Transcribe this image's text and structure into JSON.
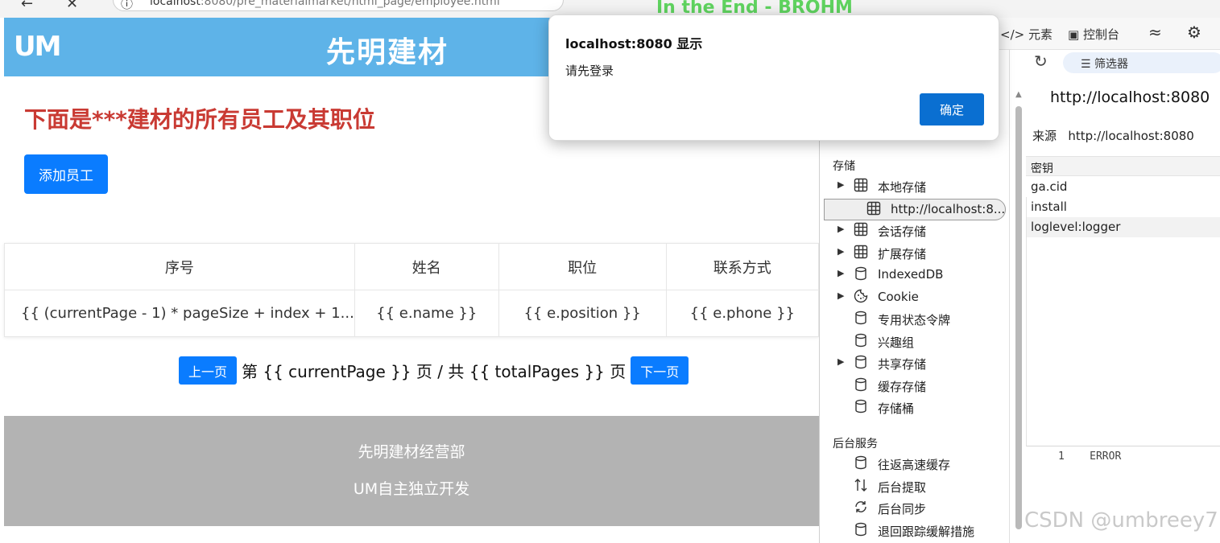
{
  "browser": {
    "url_host": "localhost",
    "url_rest": ":8080/pre_materialmarket/html_page/employee.html",
    "media_title": "In the End - BROHM"
  },
  "page": {
    "logo": "UM",
    "title": "先明建材",
    "headline": "下面是***建材的所有员工及其职位",
    "add_button": "添加员工",
    "table": {
      "headers": [
        "序号",
        "姓名",
        "职位",
        "联系方式"
      ],
      "row": [
        "{{ (currentPage - 1) * pageSize + index + 1...",
        "{{ e.name }}",
        "{{ e.position }}",
        "{{ e.phone }}"
      ]
    },
    "pager": {
      "prev": "上一页",
      "text": "第 {{ currentPage }} 页 / 共 {{ totalPages }} 页",
      "next": "下一页"
    },
    "footer": {
      "line1": "先明建材经营部",
      "line2": "UM自主独立开发"
    }
  },
  "devtools": {
    "tabs": {
      "elements": "元素",
      "console": "控制台"
    },
    "filter_label": "筛选器",
    "storage_section": "存储",
    "storage_items": [
      {
        "label": "本地存储",
        "icon": "table-icon",
        "expand": true
      },
      {
        "label": "http://localhost:8...",
        "icon": "table-icon",
        "expand": false,
        "selected": true
      },
      {
        "label": "会话存储",
        "icon": "table-icon",
        "expand": true
      },
      {
        "label": "扩展存储",
        "icon": "table-icon",
        "expand": true
      },
      {
        "label": "IndexedDB",
        "icon": "database-icon",
        "expand": true
      },
      {
        "label": "Cookie",
        "icon": "cookie-icon",
        "expand": true
      },
      {
        "label": "专用状态令牌",
        "icon": "database-icon",
        "expand": false
      },
      {
        "label": "兴趣组",
        "icon": "database-icon",
        "expand": false
      },
      {
        "label": "共享存储",
        "icon": "database-icon",
        "expand": true
      },
      {
        "label": "缓存存储",
        "icon": "database-icon",
        "expand": false
      },
      {
        "label": "存储桶",
        "icon": "database-icon",
        "expand": false
      }
    ],
    "services_section": "后台服务",
    "service_items": [
      {
        "label": "往返高速缓存",
        "icon": "database-icon"
      },
      {
        "label": "后台提取",
        "icon": "arrows-updown-icon"
      },
      {
        "label": "后台同步",
        "icon": "sync-icon"
      },
      {
        "label": "退回跟踪缓解措施",
        "icon": "database-icon"
      }
    ],
    "origin_title": "http://localhost:8080",
    "source_label": "来源",
    "source_value": "http://localhost:8080",
    "key_header": "密钥",
    "keys": [
      "ga.cid",
      "install",
      "loglevel:logger"
    ],
    "value_line_no": "1",
    "value_text": "ERROR"
  },
  "dialog": {
    "title": "localhost:8080 显示",
    "message": "请先登录",
    "ok": "确定"
  },
  "watermark": "CSDN @umbreey7"
}
